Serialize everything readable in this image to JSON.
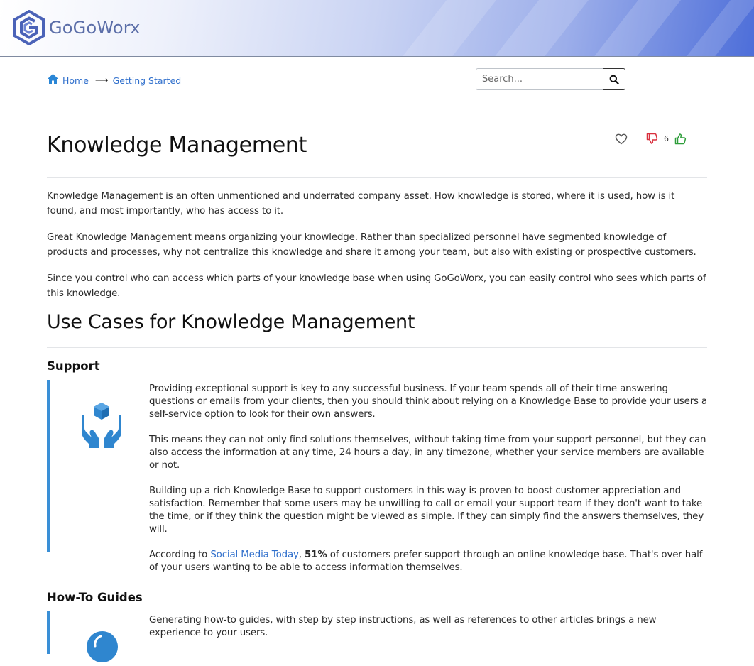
{
  "header": {
    "logo_text": "GoGoWorx"
  },
  "breadcrumb": {
    "home": "Home",
    "separator": "⟶",
    "current": "Getting Started"
  },
  "search": {
    "placeholder": "Search..."
  },
  "page": {
    "title": "Knowledge Management",
    "likes_count": "6",
    "intro": [
      "Knowledge Management is an often unmentioned and underrated company asset. How knowledge is stored, where it is used, how is it found, and most importantly, who has access to it.",
      "Great Knowledge Management means organizing your knowledge. Rather than specialized personnel have segmented knowledge of products and processes, why not centralize this knowledge and share it among your team, but also with existing or prospective customers.",
      "Since you control who can access which parts of your knowledge base when using GoGoWorx, you can easily control who sees which parts of this knowledge."
    ],
    "section_title": "Use Cases for Knowledge Management",
    "support": {
      "heading": "Support",
      "icon": "hands-box-icon",
      "paragraphs": [
        "Providing exceptional support is key to any successful business. If your team spends all of their time answering questions or emails from your clients, then you should think about relying on a Knowledge Base to provide your users a self-service option to look for their own answers.",
        "This means they can not only find solutions themselves, without taking time from your support personnel, but they can also access the information at any time, 24 hours a day, in any timezone, whether your service members are available or not.",
        "Building up a rich Knowledge Base to support customers in this way is proven to boost customer appreciation and satisfaction. Remember that some users may be unwilling to call or email your support team if they don't want to take the time, or if they think the question might be viewed as simple. If they can simply find the answers themselves, they will."
      ],
      "last_prefix": "According to ",
      "last_link": "Social Media Today",
      "last_sep": ", ",
      "last_bold": "51%",
      "last_suffix": " of customers prefer support through an online knowledge base. That's over half of your users wanting to be able to access information themselves."
    },
    "howto": {
      "heading": "How-To Guides",
      "icon": "compass-icon",
      "paragraph": "Generating how-to guides, with step by step instructions, as well as references to other articles brings a new experience to your users."
    }
  },
  "colors": {
    "accent": "#3a8fd6",
    "link": "#2f6fcc",
    "dislike": "#d9303e",
    "like": "#2e9e3a"
  }
}
